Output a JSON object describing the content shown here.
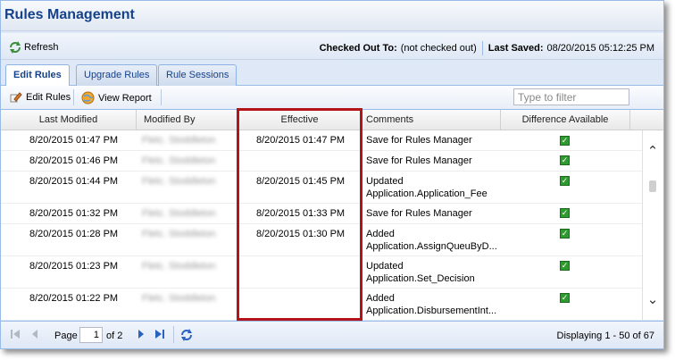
{
  "window": {
    "title": "Rules Management"
  },
  "info_bar": {
    "refresh_label": "Refresh",
    "checked_out_label": "Checked Out To:",
    "checked_out_value": "(not checked out)",
    "last_saved_label": "Last Saved:",
    "last_saved_value": "08/20/2015 05:12:25 PM"
  },
  "tabs": [
    {
      "label": "Edit Rules",
      "active": true
    },
    {
      "label": "Upgrade Rules",
      "active": false
    },
    {
      "label": "Rule Sessions",
      "active": false
    }
  ],
  "toolbar": {
    "edit_rules_label": "Edit Rules",
    "view_report_label": "View Report",
    "filter_placeholder": "Type to filter"
  },
  "grid": {
    "columns": [
      "Last Modified",
      "Modified By",
      "Effective",
      "Comments",
      "Difference Available"
    ],
    "rows": [
      {
        "last_modified": "8/20/2015 01:47 PM",
        "modified_by": "Fletc. Stoddleton",
        "effective": "8/20/2015 01:47 PM",
        "comment_1": "Save for Rules Manager",
        "comment_2": "",
        "difference": true
      },
      {
        "last_modified": "8/20/2015 01:46 PM",
        "modified_by": "Fletc. Stoddleton",
        "effective": "",
        "comment_1": "Save for Rules Manager",
        "comment_2": "",
        "difference": true
      },
      {
        "last_modified": "8/20/2015 01:44 PM",
        "modified_by": "Fletc. Stoddleton",
        "effective": "8/20/2015 01:45 PM",
        "comment_1": "Updated",
        "comment_2": "Application.Application_Fee",
        "difference": true
      },
      {
        "last_modified": "8/20/2015 01:32 PM",
        "modified_by": "Fletc. Stoddleton",
        "effective": "8/20/2015 01:33 PM",
        "comment_1": "Save for Rules Manager",
        "comment_2": "",
        "difference": true
      },
      {
        "last_modified": "8/20/2015 01:28 PM",
        "modified_by": "Fletc. Stoddleton",
        "effective": "8/20/2015 01:30 PM",
        "comment_1": "Added",
        "comment_2": "Application.AssignQueuByD...",
        "difference": true
      },
      {
        "last_modified": "8/20/2015 01:23 PM",
        "modified_by": "Fletc. Stoddleton",
        "effective": "",
        "comment_1": "Updated",
        "comment_2": "Application.Set_Decision",
        "difference": true
      },
      {
        "last_modified": "8/20/2015 01:22 PM",
        "modified_by": "Fletc. Stoddleton",
        "effective": "",
        "comment_1": "Added",
        "comment_2": "Application.DisbursementInt...",
        "difference": true
      }
    ]
  },
  "pager": {
    "page_label": "Page",
    "current_page": "1",
    "of_label": "of 2",
    "displaying": "Displaying 1 - 50 of 67"
  },
  "colors": {
    "accent": "#15428b",
    "highlight_border": "#b3141a",
    "check_green": "#2f9a2f"
  }
}
